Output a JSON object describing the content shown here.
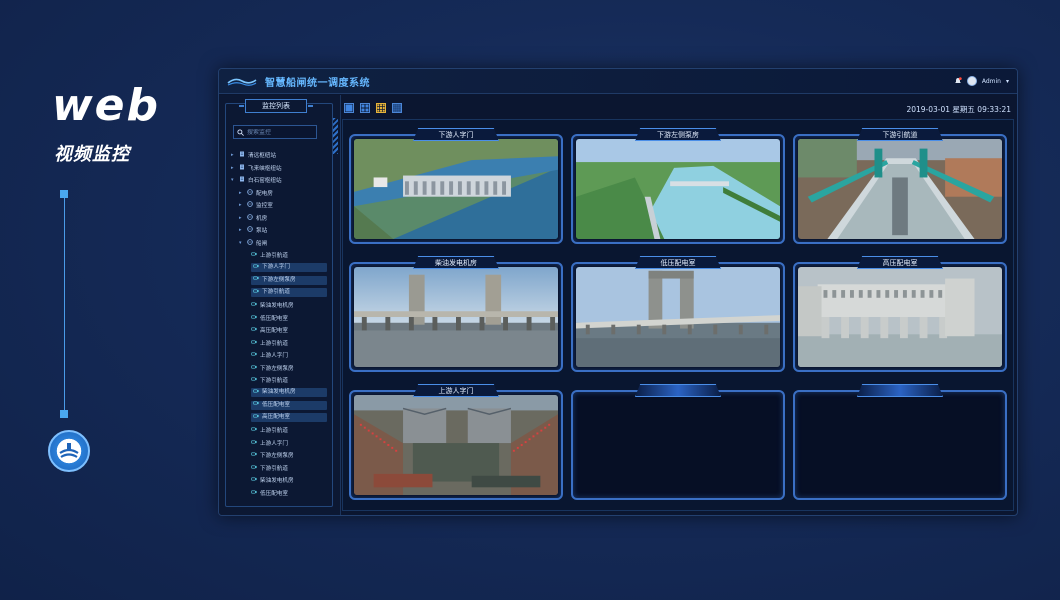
{
  "showcase": {
    "title": "web",
    "subtitle": "视频监控"
  },
  "app": {
    "title": "智慧船闸统一调度系统",
    "user": "Admin",
    "datetime": "2019-03-01  星期五  09:33:21"
  },
  "sidebar": {
    "heading": "监控列表",
    "search_placeholder": "搜索监控",
    "tree": [
      {
        "label": "清远枢纽站",
        "level": 1,
        "arrow": "▸",
        "icon": "document-icon"
      },
      {
        "label": "飞来峡枢纽站",
        "level": 1,
        "arrow": "▸",
        "icon": "document-icon"
      },
      {
        "label": "白石窑枢纽站",
        "level": 1,
        "arrow": "▾",
        "icon": "document-icon"
      },
      {
        "label": "配电房",
        "level": 2,
        "arrow": "▸",
        "icon": "globe-icon"
      },
      {
        "label": "监控室",
        "level": 2,
        "arrow": "▸",
        "icon": "globe-icon"
      },
      {
        "label": "机房",
        "level": 2,
        "arrow": "▸",
        "icon": "globe-icon"
      },
      {
        "label": "泵站",
        "level": 2,
        "arrow": "▸",
        "icon": "globe-icon"
      },
      {
        "label": "船闸",
        "level": 2,
        "arrow": "▾",
        "icon": "globe-icon"
      },
      {
        "label": "上游引航道",
        "level": 3,
        "selected": false,
        "icon": "camera-icon"
      },
      {
        "label": "下游人字门",
        "level": 3,
        "selected": true,
        "icon": "camera-icon"
      },
      {
        "label": "下游左侧泵房",
        "level": 3,
        "selected": true,
        "icon": "camera-icon"
      },
      {
        "label": "下游引航道",
        "level": 3,
        "selected": true,
        "icon": "camera-icon"
      },
      {
        "label": "柴油发电机房",
        "level": 3,
        "selected": false,
        "icon": "camera-icon"
      },
      {
        "label": "低压配电室",
        "level": 3,
        "selected": false,
        "icon": "camera-icon"
      },
      {
        "label": "高压配电室",
        "level": 3,
        "selected": false,
        "icon": "camera-icon"
      },
      {
        "label": "上游引航道",
        "level": 3,
        "selected": false,
        "icon": "camera-icon"
      },
      {
        "label": "上游人字门",
        "level": 3,
        "selected": false,
        "icon": "camera-icon"
      },
      {
        "label": "下游左侧泵房",
        "level": 3,
        "selected": false,
        "icon": "camera-icon"
      },
      {
        "label": "下游引航道",
        "level": 3,
        "selected": false,
        "icon": "camera-icon"
      },
      {
        "label": "柴油发电机房",
        "level": 3,
        "selected": true,
        "icon": "camera-icon"
      },
      {
        "label": "低压配电室",
        "level": 3,
        "selected": true,
        "icon": "camera-icon"
      },
      {
        "label": "高压配电室",
        "level": 3,
        "selected": true,
        "icon": "camera-icon"
      },
      {
        "label": "上游引航道",
        "level": 3,
        "selected": false,
        "icon": "camera-icon"
      },
      {
        "label": "上游人字门",
        "level": 3,
        "selected": false,
        "icon": "camera-icon"
      },
      {
        "label": "下游左侧泵房",
        "level": 3,
        "selected": false,
        "icon": "camera-icon"
      },
      {
        "label": "下游引航道",
        "level": 3,
        "selected": false,
        "icon": "camera-icon"
      },
      {
        "label": "柴油发电机房",
        "level": 3,
        "selected": false,
        "icon": "camera-icon"
      },
      {
        "label": "低压配电室",
        "level": 3,
        "selected": false,
        "icon": "camera-icon"
      }
    ]
  },
  "layout_buttons": [
    {
      "name": "layout-1x1-button",
      "active": false
    },
    {
      "name": "layout-2x2-button",
      "active": false
    },
    {
      "name": "layout-3x3-button",
      "active": true
    },
    {
      "name": "layout-4x4-button",
      "active": false
    }
  ],
  "video_cells": [
    {
      "label": "下游人字门",
      "scene": "lock-gate-aerial"
    },
    {
      "label": "下游左侧泵房",
      "scene": "river-aerial"
    },
    {
      "label": "下游引航道",
      "scene": "lock-chamber"
    },
    {
      "label": "柴油发电机房",
      "scene": "bridge-towers"
    },
    {
      "label": "低压配电室",
      "scene": "bridge-tower-single"
    },
    {
      "label": "高压配电室",
      "scene": "dam-building"
    },
    {
      "label": "上游人字门",
      "scene": "lock-ceremony"
    },
    {
      "label": "",
      "scene": "empty"
    },
    {
      "label": "",
      "scene": "empty"
    }
  ],
  "colors": {
    "accent": "#3a6fc4",
    "title": "#66b8ff",
    "selected_row": "#1c3b68",
    "active_layout": "#e6b43a"
  }
}
